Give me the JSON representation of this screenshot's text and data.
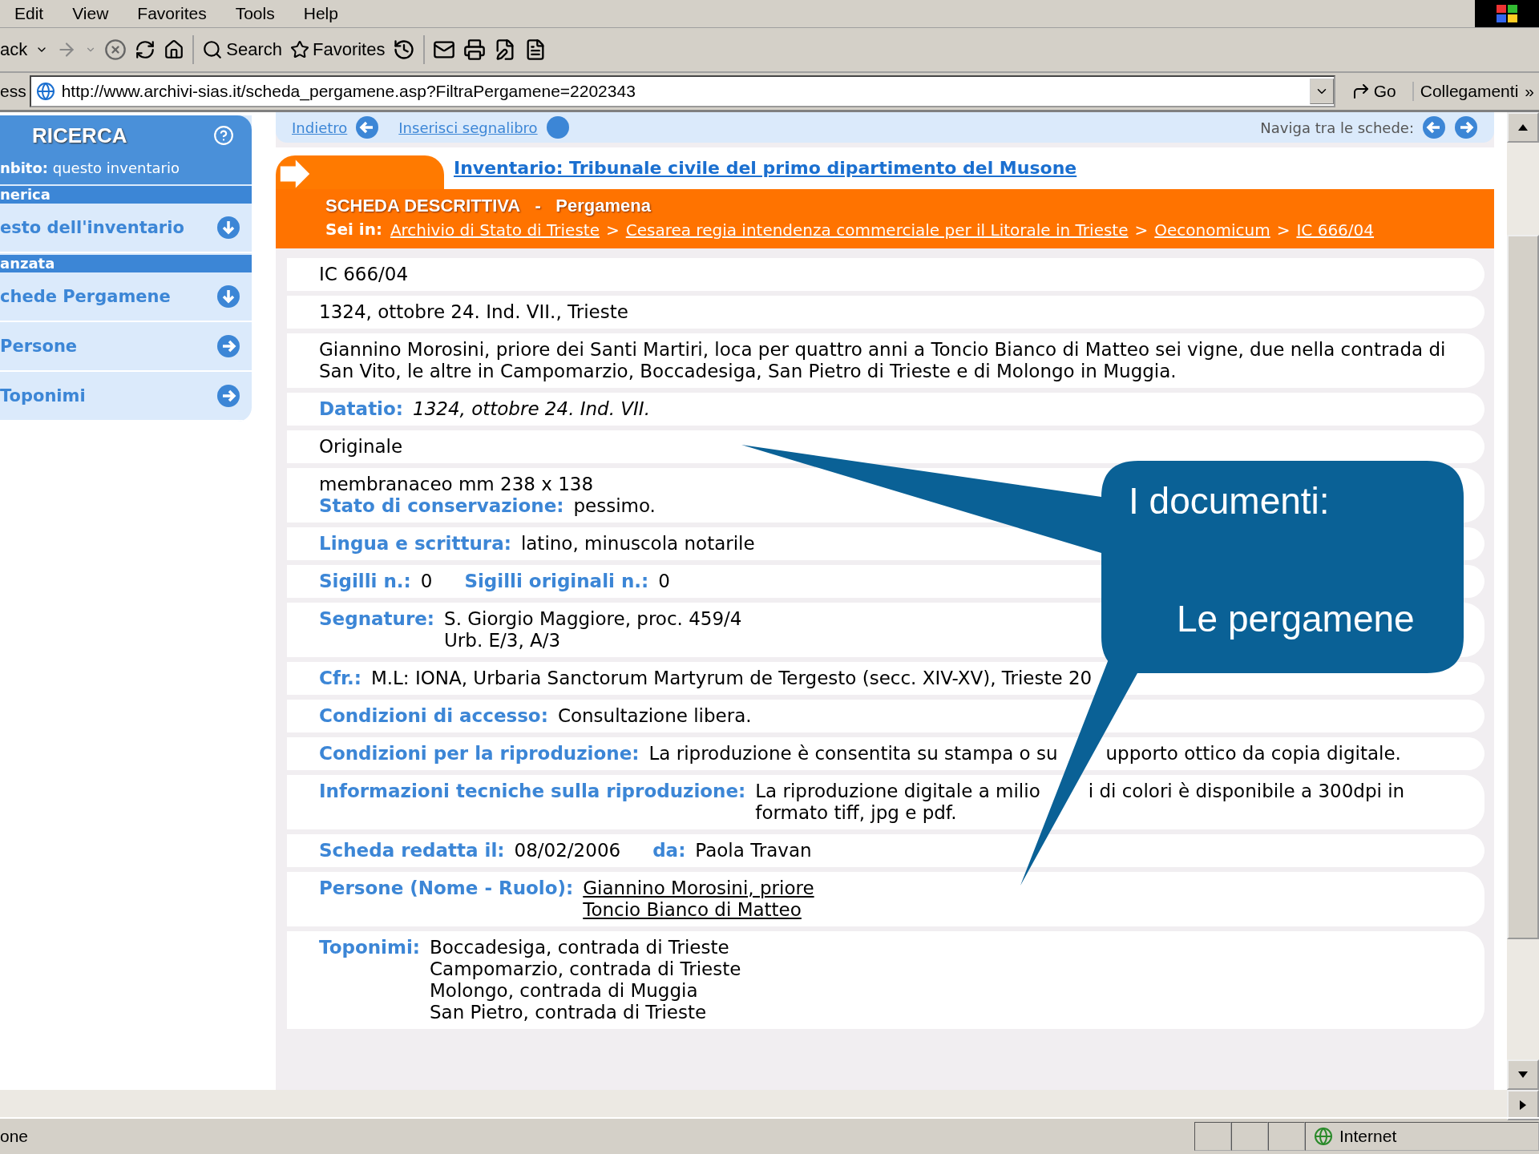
{
  "menu": [
    "Edit",
    "View",
    "Favorites",
    "Tools",
    "Help"
  ],
  "toolbar": {
    "back": "ack",
    "search": "Search",
    "favorites": "Favorites"
  },
  "address": {
    "label": "ess",
    "url": "http://www.archivi-sias.it/scheda_pergamene.asp?FiltraPergamene=2202343",
    "go": "Go",
    "links": "Collegamenti",
    "more": "»"
  },
  "sidebar": {
    "title": "RICERCA",
    "scope": "**nbito:** questo inventario",
    "items": [
      {
        "kind": "band",
        "label": "nerica"
      },
      {
        "kind": "expand",
        "label": "esto dell'inventario"
      },
      {
        "kind": "band",
        "label": "anzata"
      },
      {
        "kind": "expand",
        "label": "chede Pergamene"
      },
      {
        "kind": "link",
        "label": "Persone"
      },
      {
        "kind": "link",
        "label": "Toponimi"
      }
    ]
  },
  "nav": {
    "back": "Indietro",
    "bookmark": "Inserisci segnalibro",
    "browse": "Naviga tra le schede:"
  },
  "inventory_link": "Inventario: Tribunale civile del primo dipartimento del Musone",
  "card": {
    "title": "SCHEDA DESCRITTIVA",
    "separator": "-",
    "subtitle": "Pergamena",
    "breadcrumb_label": "Sei in:",
    "breadcrumb": [
      "Archivio di Stato di Trieste",
      "Cesarea regia intendenza commerciale per il Litorale in Trieste",
      "Oeconomicum",
      "IC 666/04"
    ],
    "breadcrumb_separator": ">"
  },
  "rows": [
    {
      "lines": [
        [
          {
            "kind": "plain",
            "text": "IC 666/04"
          }
        ]
      ]
    },
    {
      "lines": [
        [
          {
            "kind": "plain",
            "text": "1324, ottobre 24. Ind. VII., Trieste"
          }
        ]
      ]
    },
    {
      "lines": [
        [
          {
            "kind": "plain",
            "text": "Giannino Morosini, priore dei Santi Martiri, loca per quattro anni a Toncio Bianco di Matteo sei vigne, due nella contrada di San Vito, le altre in Campomarzio, Boccadesiga, San Pietro di Trieste e di Molongo in Muggia."
          }
        ]
      ]
    },
    {
      "lines": [
        [
          {
            "kind": "field",
            "label": "Datatio:",
            "values": [
              "1324, ottobre 24. Ind. VII."
            ],
            "italic": true
          }
        ]
      ]
    },
    {
      "lines": [
        [
          {
            "kind": "plain",
            "text": "Originale"
          }
        ]
      ]
    },
    {
      "lines": [
        [
          {
            "kind": "plain",
            "text": "membranaceo mm 238 x 138"
          }
        ],
        [
          {
            "kind": "field",
            "label": "Stato di conservazione:",
            "values": [
              "pessimo."
            ]
          }
        ]
      ]
    },
    {
      "lines": [
        [
          {
            "kind": "field",
            "label": "Lingua e scrittura:",
            "values": [
              "latino, minuscola notarile"
            ]
          }
        ]
      ]
    },
    {
      "lines": [
        [
          {
            "kind": "field",
            "label": "Sigilli n.:",
            "values": [
              "0"
            ]
          },
          {
            "kind": "field",
            "label": "Sigilli originali n.:",
            "values": [
              "0"
            ]
          }
        ]
      ]
    },
    {
      "lines": [
        [
          {
            "kind": "field",
            "label": "Segnature:",
            "values": [
              "S. Giorgio Maggiore, proc. 459/4",
              "Urb. E/3, A/3"
            ]
          }
        ]
      ]
    },
    {
      "lines": [
        [
          {
            "kind": "field",
            "label": "Cfr.:",
            "values": [
              "M.L: IONA, Urbaria Sanctorum Martyrum de Tergesto (secc. XIV-XV), Trieste 20"
            ]
          }
        ]
      ]
    },
    {
      "lines": [
        [
          {
            "kind": "field",
            "label": "Condizioni di accesso:",
            "values": [
              "Consultazione libera."
            ]
          }
        ]
      ]
    },
    {
      "lines": [
        [
          {
            "kind": "field",
            "label": "Condizioni per la riproduzione:",
            "values": [
              [
                "La riproduzione è consentita su stampa o su",
                "upporto ottico da copia digitale."
              ]
            ]
          }
        ]
      ]
    },
    {
      "lines": [
        [
          {
            "kind": "field",
            "label": "Informazioni tecniche sulla riproduzione:",
            "values": [
              [
                "La riproduzione digitale a milio",
                "i di colori è disponibile a 300dpi in"
              ],
              "formato tiff, jpg e pdf."
            ]
          }
        ]
      ]
    },
    {
      "lines": [
        [
          {
            "kind": "field",
            "label": "Scheda redatta il:",
            "values": [
              "08/02/2006"
            ]
          },
          {
            "kind": "field",
            "label": "da:",
            "values": [
              "Paola Travan"
            ]
          }
        ]
      ]
    },
    {
      "lines": [
        [
          {
            "kind": "field",
            "label": "Persone (Nome - Ruolo):",
            "values": [
              "Giannino Morosini, priore",
              "Toncio Bianco di Matteo"
            ],
            "link": true
          }
        ]
      ]
    },
    {
      "lines": [
        [
          {
            "kind": "field",
            "label": "Toponimi:",
            "values": [
              "Boccadesiga, contrada di Trieste",
              "Campomarzio, contrada di Trieste",
              "Molongo, contrada di Muggia",
              "San Pietro, contrada di Trieste"
            ]
          }
        ]
      ]
    }
  ],
  "callout": {
    "heading": "I documenti:",
    "text": "Le pergamene"
  },
  "status": {
    "text": "one",
    "zone": "Internet"
  }
}
